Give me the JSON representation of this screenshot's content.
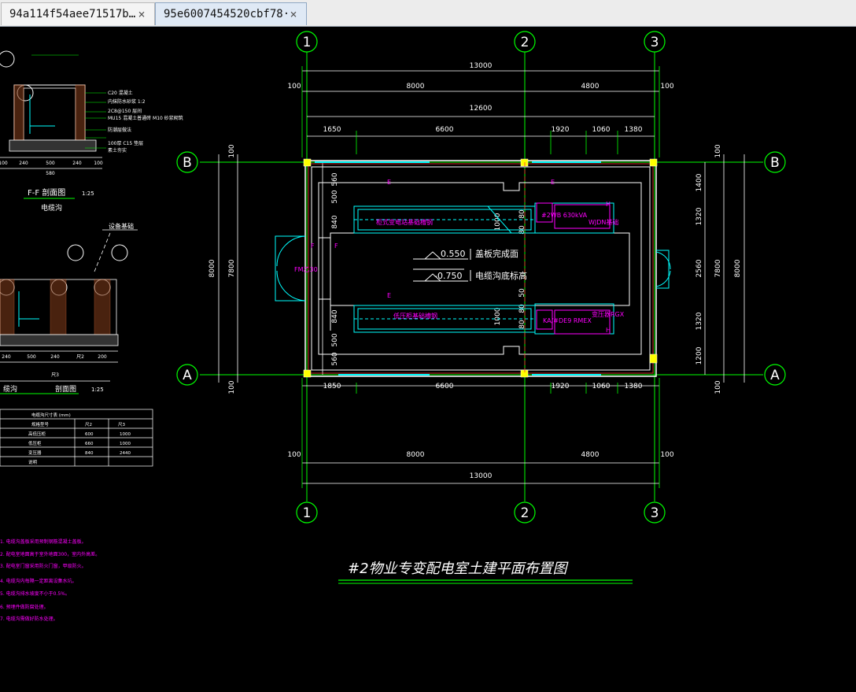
{
  "tabs": [
    {
      "label": "94a114f54aee71517b…",
      "close": "×"
    },
    {
      "label": "95e6007454520cbf78·",
      "close": "×"
    }
  ],
  "grid": {
    "cols": [
      "1",
      "2",
      "3"
    ],
    "rows": [
      "B",
      "A"
    ]
  },
  "dims": {
    "total": "13000",
    "left": "8000",
    "right": "4800",
    "edge": "100",
    "inner": "12600",
    "sub": [
      "1650",
      "6600",
      "1920",
      "1060",
      "1380"
    ],
    "subBottom": [
      "1850",
      "6600",
      "1920",
      "1060",
      "1380"
    ],
    "vTotal": "8000",
    "vInner": "7800",
    "vEdge": "100",
    "vRight": [
      "1400",
      "1320",
      "2560",
      "1320",
      "1200"
    ],
    "vLeftSmall": [
      "560",
      "500",
      "840",
      "840",
      "500",
      "560"
    ],
    "midSmall": [
      "80",
      "80",
      "50",
      "80",
      "80"
    ],
    "boxH": "1000"
  },
  "levels": {
    "top_value": "0.550",
    "top_label": "盖板完成面",
    "bottom_value": "-0.750",
    "bottom_label": "电缆沟底标高"
  },
  "equipment": {
    "upper_pink": "柜式变电站基础槽钢",
    "upper_tx": "#2WB 630kVA",
    "upper_right": "WJDN基础",
    "lower_pink": "低压柜基础槽钢",
    "lower_tx": "KA/#DE9 RMEX",
    "lower_right": "变压器RGX",
    "door": "FM乙30",
    "markers": [
      "E",
      "E",
      "E",
      "H",
      "H",
      "F",
      "F"
    ]
  },
  "drawing_title": "#2物业专变配电室土建平面布置图",
  "left_details": {
    "section1_title": "F-F  剖面图",
    "section1_scale": "1:25",
    "section1_sub": "电缆沟",
    "section2_title": "剖面图",
    "section2_prefix": "缆沟",
    "section2_scale": "1:25",
    "slope_note": "设备基础",
    "dims1": [
      "100",
      "240",
      "500",
      "240",
      "100"
    ],
    "dim1_total": "580",
    "dims2": [
      "240",
      "500",
      "200",
      "240"
    ],
    "dim2_mid": "尺2",
    "dim2_total": "尺3",
    "callouts": [
      "C20  混凝土",
      "内抹防水砂浆 1:2",
      "2C8@150 层间",
      "MU15 混凝土普通砖 M10 砂浆砌筑",
      "防潮层做法",
      "100厚 C15 垫层",
      "素土夯实"
    ]
  },
  "table": {
    "title": "电缆沟尺寸表 (mm)",
    "headers": [
      "规格型号",
      "尺2",
      "尺3"
    ],
    "rows": [
      [
        "高低压柜",
        "600",
        "1000"
      ],
      [
        "低压柜",
        "660",
        "1000"
      ],
      [
        "变压器",
        "840",
        "2440"
      ],
      [
        "说明",
        "",
        " "
      ]
    ]
  },
  "notes": [
    "1. 电缆沟盖板采用预制钢筋混凝土盖板。",
    "2. 配电室地面高于室外地面300，室内外高差。",
    "3. 配电室门窗采用防火门窗，甲级防火。",
    "4. 电缆沟内每隔一定距离设集水坑。",
    "5. 电缆沟排水坡度不小于0.5%。",
    "6. 预埋件做防腐处理。",
    "7. 电缆沟需做好防水处理。"
  ],
  "colors": {
    "grid": "#00ff00",
    "wall": "#ffffff",
    "cyan": "#00ffff",
    "magenta": "#ff00ff",
    "yellow": "#ffff00",
    "red": "#ff3030",
    "bg": "#000000"
  }
}
